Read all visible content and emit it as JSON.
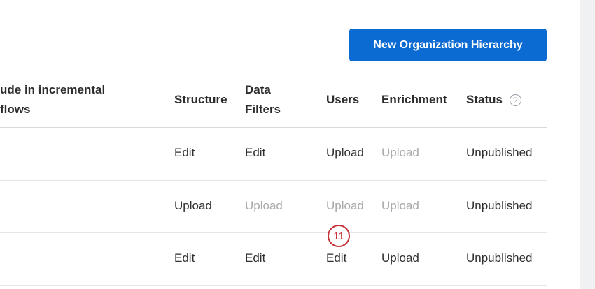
{
  "toolbar": {
    "new_button_label": "New Organization Hierarchy"
  },
  "table": {
    "headers": {
      "include_line1": "ude in incremental",
      "include_line2": "flows",
      "structure": "Structure",
      "data_filters_line1": "Data",
      "data_filters_line2": "Filters",
      "users": "Users",
      "enrichment": "Enrichment",
      "status": "Status"
    },
    "rows": [
      {
        "structure": "Edit",
        "data_filters": "Edit",
        "users": "Upload",
        "enrichment": "Upload",
        "status": "Unpublished"
      },
      {
        "structure": "Upload",
        "data_filters": "Upload",
        "users": "Upload",
        "enrichment": "Upload",
        "status": "Unpublished"
      },
      {
        "structure": "Edit",
        "data_filters": "Edit",
        "users": "Edit",
        "enrichment": "Upload",
        "status": "Unpublished"
      }
    ]
  },
  "annotation": {
    "step_number": "11"
  },
  "icons": {
    "status_help": "question-circle-icon"
  },
  "colors": {
    "primary": "#0b6bd3",
    "muted_text": "#a8a8a8",
    "annotation": "#c4323a",
    "gutter": "#f0f1f3"
  }
}
